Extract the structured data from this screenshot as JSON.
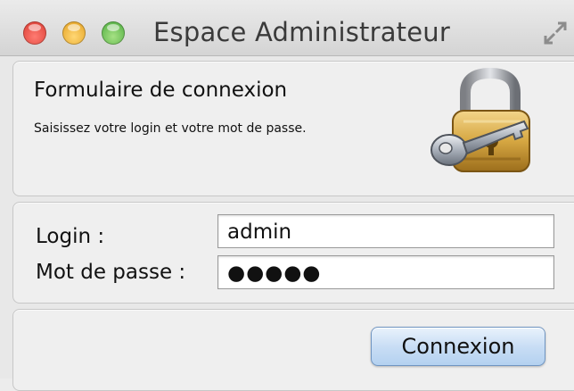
{
  "window": {
    "title": "Espace Administrateur"
  },
  "header": {
    "title": "Formulaire de connexion",
    "subtitle": "Saisissez votre login et votre mot de passe."
  },
  "form": {
    "login_label": "Login :",
    "login_value": "admin",
    "password_label": "Mot de passe :",
    "password_value": "●●●●●"
  },
  "actions": {
    "submit_label": "Connexion"
  },
  "icons": {
    "close": "close-icon",
    "minimize": "minimize-icon",
    "zoom": "zoom-icon",
    "fullscreen": "fullscreen-icon",
    "header": "padlock-key-icon"
  },
  "colors": {
    "accent": "#b4d1f0",
    "close": "#d8382e",
    "minimize": "#e29d1c",
    "zoom": "#48a93b"
  }
}
